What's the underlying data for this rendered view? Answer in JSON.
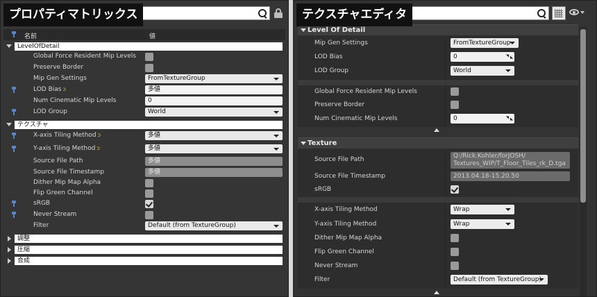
{
  "left": {
    "banner": "プロパティマトリックス",
    "header": {
      "name_col": "名前",
      "value_col": "値"
    },
    "categories": {
      "lod": "LevelOfDetail",
      "texture": "テクスチャ",
      "adjust": "調整",
      "compress": "圧縮",
      "composite": "合成"
    },
    "rows": {
      "global_force": "Global Force Resident Mip Levels",
      "preserve_border": "Preserve Border",
      "mip_gen": {
        "label": "Mip Gen Settings",
        "value": "FromTextureGroup"
      },
      "lod_bias": {
        "label": "LOD Bias",
        "value": "多値"
      },
      "num_cine": {
        "label": "Num Cinematic Mip Levels",
        "value": "0"
      },
      "lod_group": {
        "label": "LOD Group",
        "value": "World"
      },
      "x_tiling": {
        "label": "X-axis Tiling Method",
        "value": "多値"
      },
      "y_tiling": {
        "label": "Y-axis Tiling Method",
        "value": "多値"
      },
      "src_path": {
        "label": "Source File Path",
        "value": "多値"
      },
      "src_time": {
        "label": "Source File Timestamp",
        "value": "多値"
      },
      "dither": "Dither Mip Map Alpha",
      "flip_green": "Flip Green Channel",
      "srgb": "sRGB",
      "never_stream": "Never Stream",
      "filter": {
        "label": "Filter",
        "value": "Default (from TextureGroup)"
      }
    },
    "reset_glyph": "ↄ"
  },
  "right": {
    "banner": "テクスチャエディタ",
    "sections": {
      "lod": "Level Of Detail",
      "texture": "Texture"
    },
    "rows": {
      "mip_gen": {
        "label": "Mip Gen Settings",
        "value": "FromTextureGroup"
      },
      "lod_bias": {
        "label": "LOD Bias",
        "value": "0"
      },
      "lod_group": {
        "label": "LOD Group",
        "value": "World"
      },
      "global_force": "Global Force Resident Mip Levels",
      "preserve_border": "Preserve Border",
      "num_cine": {
        "label": "Num Cinematic Mip Levels",
        "value": "0"
      },
      "src_path": {
        "label": "Source File Path",
        "value_line1": "Q:/Rick.Kohler/forJOSH/",
        "value_line2": "Textures_WIP/T_Floor_Tiles_rk_D.tga"
      },
      "src_time": {
        "label": "Source File Timestamp",
        "value": "2013.04.18-15.20.50"
      },
      "srgb": "sRGB",
      "x_tiling": {
        "label": "X-axis Tiling Method",
        "value": "Wrap"
      },
      "y_tiling": {
        "label": "Y-axis Tiling Method",
        "value": "Wrap"
      },
      "dither": "Dither Mip Map Alpha",
      "flip_green": "Flip Green Channel",
      "never_stream": "Never Stream",
      "filter": {
        "label": "Filter",
        "value": "Default (from TextureGroup)"
      }
    }
  }
}
